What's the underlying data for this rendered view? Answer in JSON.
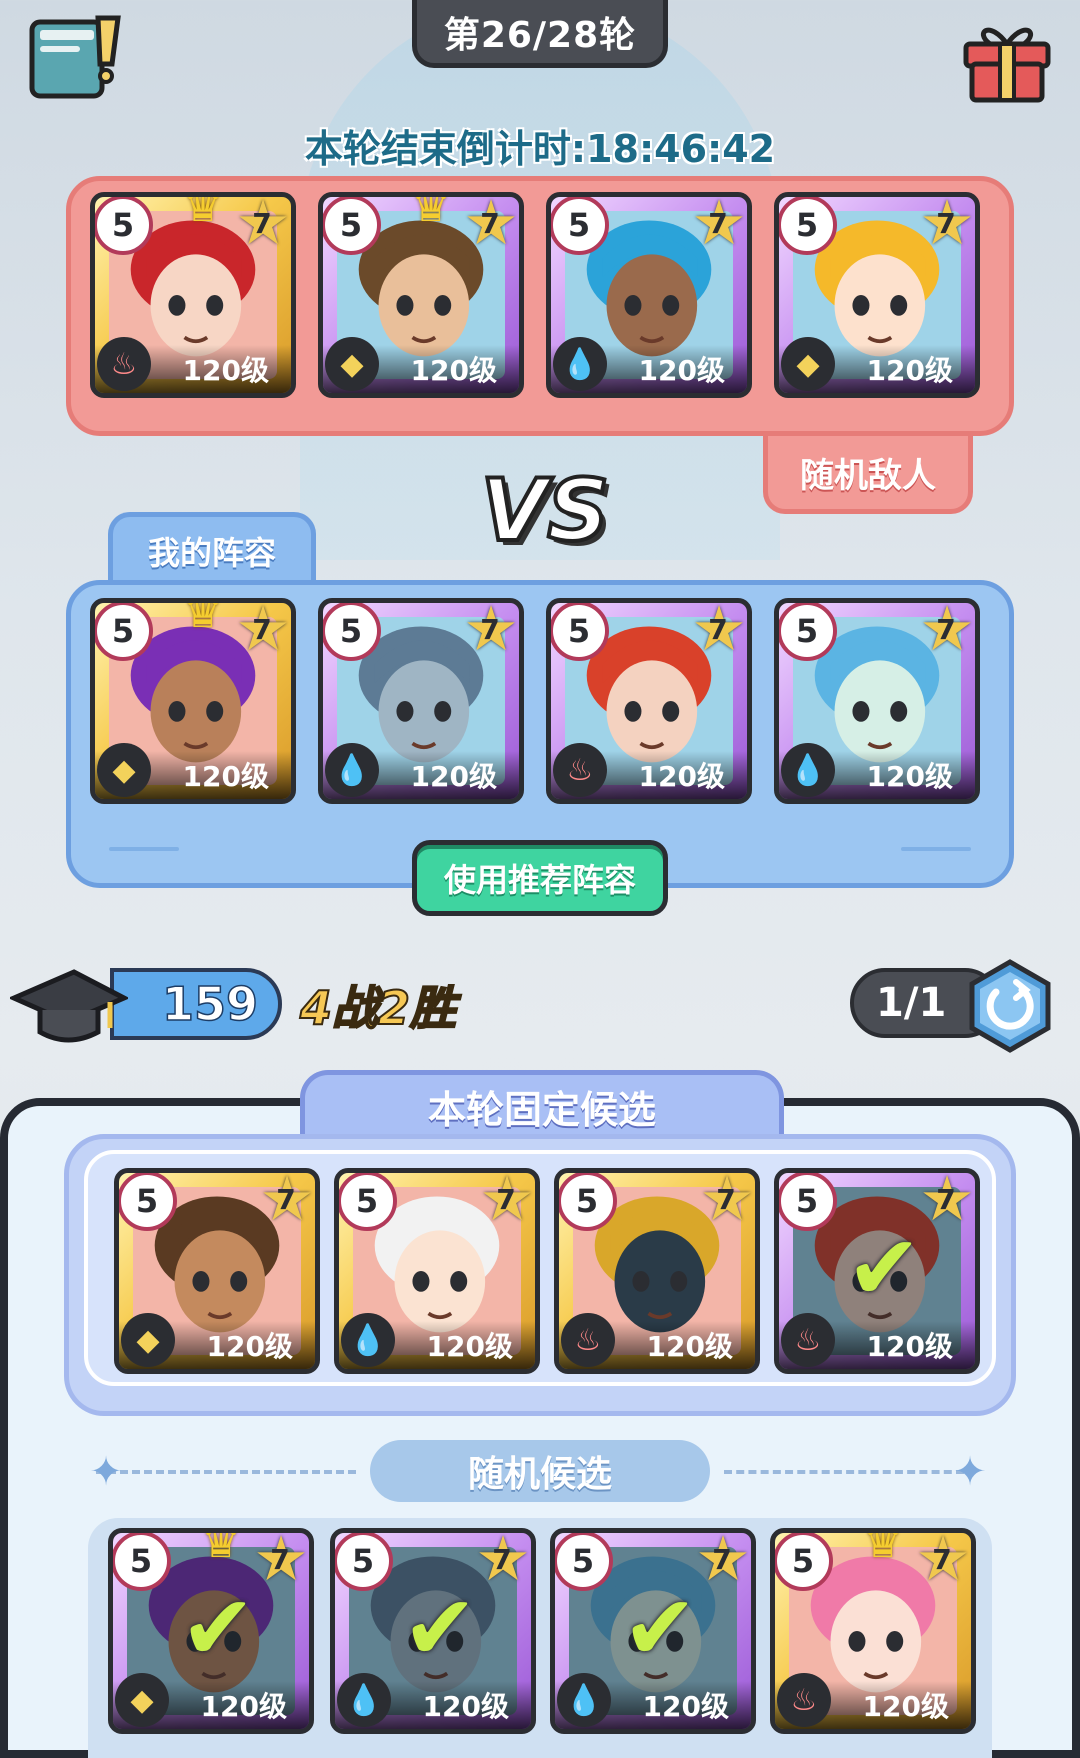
{
  "header": {
    "round": "第26/28轮",
    "countdown": "本轮结束倒计时:18:46:42"
  },
  "enemy": {
    "tag": "随机敌人",
    "heroes": [
      {
        "rank": "5",
        "stars": "7",
        "level": "120级",
        "element": "fire",
        "crown": true,
        "frame": "gold",
        "face": "#f7d6c5",
        "hair": "#c9262b"
      },
      {
        "rank": "5",
        "stars": "7",
        "level": "120级",
        "element": "earth",
        "crown": true,
        "frame": "purple",
        "face": "#e9bf9a",
        "hair": "#6b4a2a"
      },
      {
        "rank": "5",
        "stars": "7",
        "level": "120级",
        "element": "water",
        "crown": false,
        "frame": "purple",
        "face": "#9a6a4c",
        "hair": "#2ba3d9"
      },
      {
        "rank": "5",
        "stars": "7",
        "level": "120级",
        "element": "earth",
        "crown": false,
        "frame": "purple",
        "face": "#fde1cd",
        "hair": "#f5b92a"
      }
    ]
  },
  "vs": "VS",
  "my_team": {
    "tag": "我的阵容",
    "recommend_button": "使用推荐阵容",
    "heroes": [
      {
        "rank": "5",
        "stars": "7",
        "level": "120级",
        "element": "earth",
        "crown": true,
        "frame": "gold",
        "face": "#b9805a",
        "hair": "#7a2fb5"
      },
      {
        "rank": "5",
        "stars": "7",
        "level": "120级",
        "element": "water",
        "crown": false,
        "frame": "purple",
        "face": "#9fb5c4",
        "hair": "#5d7b95"
      },
      {
        "rank": "5",
        "stars": "7",
        "level": "120级",
        "element": "fire",
        "crown": false,
        "frame": "purple",
        "face": "#f4d2c0",
        "hair": "#d9412a"
      },
      {
        "rank": "5",
        "stars": "7",
        "level": "120级",
        "element": "water",
        "crown": false,
        "frame": "purple",
        "face": "#d6efe6",
        "hair": "#5bb4e3"
      }
    ]
  },
  "stats": {
    "score": "159",
    "record": "4战2胜",
    "tries": "1/1"
  },
  "fixed": {
    "title": "本轮固定候选",
    "heroes": [
      {
        "rank": "5",
        "stars": "7",
        "level": "120级",
        "element": "earth",
        "crown": false,
        "frame": "gold",
        "face": "#c48a5e",
        "hair": "#5a3a22",
        "selected": false
      },
      {
        "rank": "5",
        "stars": "7",
        "level": "120级",
        "element": "water",
        "crown": false,
        "frame": "gold",
        "face": "#fbe3d2",
        "hair": "#f2f2f2",
        "selected": false
      },
      {
        "rank": "5",
        "stars": "7",
        "level": "120级",
        "element": "fire",
        "crown": false,
        "frame": "gold",
        "face": "#2a3b48",
        "hair": "#d9a72a",
        "selected": false
      },
      {
        "rank": "5",
        "stars": "7",
        "level": "120级",
        "element": "fire",
        "crown": false,
        "frame": "purple",
        "face": "#f4d2c0",
        "hair": "#d9412a",
        "selected": true
      }
    ]
  },
  "random": {
    "title": "随机候选",
    "heroes": [
      {
        "rank": "5",
        "stars": "7",
        "level": "120级",
        "element": "earth",
        "crown": true,
        "frame": "purple",
        "face": "#b9805a",
        "hair": "#7a2fb5",
        "selected": true
      },
      {
        "rank": "5",
        "stars": "7",
        "level": "120级",
        "element": "water",
        "crown": false,
        "frame": "purple",
        "face": "#9fb5c4",
        "hair": "#5d7b95",
        "selected": true
      },
      {
        "rank": "5",
        "stars": "7",
        "level": "120级",
        "element": "water",
        "crown": false,
        "frame": "purple",
        "face": "#d6efe6",
        "hair": "#5bb4e3",
        "selected": true
      },
      {
        "rank": "5",
        "stars": "7",
        "level": "120级",
        "element": "fire",
        "crown": true,
        "frame": "gold",
        "face": "#fbe0d5",
        "hair": "#f07aa8",
        "selected": false
      }
    ]
  }
}
